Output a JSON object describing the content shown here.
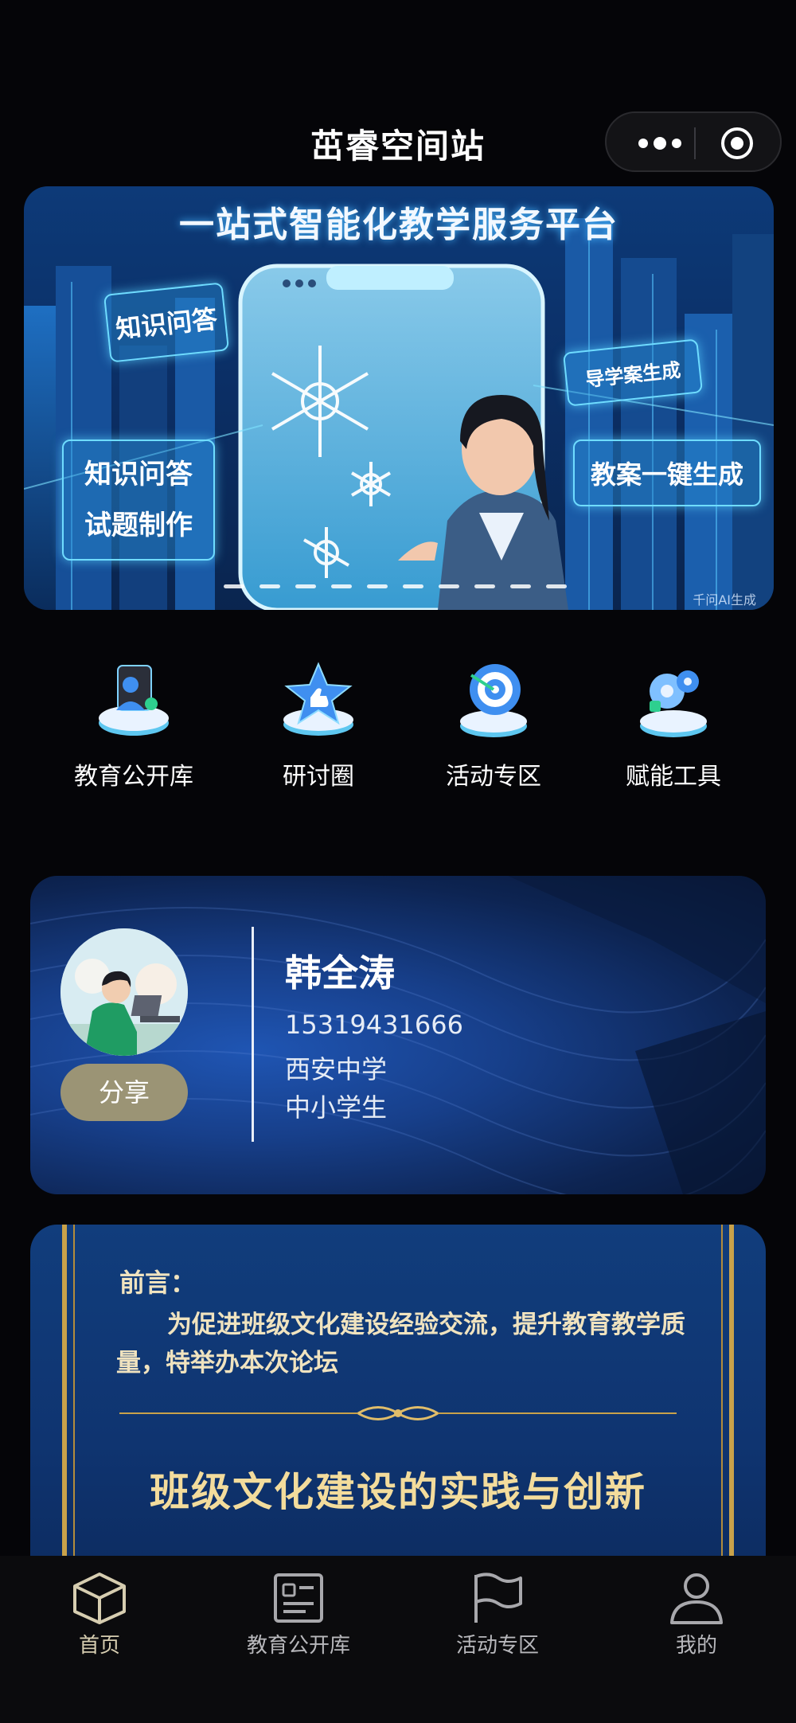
{
  "header": {
    "title": "茁睿空间站",
    "more_icon": "more-dots-icon",
    "close_icon": "target-circle-icon"
  },
  "banner": {
    "headline": "一站式智能化教学服务平台",
    "sign_top_left": "知识问答",
    "sign_left_line1": "知识问答",
    "sign_left_line2": "试题制作",
    "sign_right_small": "导学案生成",
    "sign_right_big": "教案一键生成",
    "watermark": "千问AI生成",
    "slide_count": 10,
    "active_slide": 1
  },
  "menu": {
    "items": [
      {
        "label": "教育公开库",
        "icon": "education-library-icon"
      },
      {
        "label": "研讨圈",
        "icon": "discussion-star-icon"
      },
      {
        "label": "活动专区",
        "icon": "activity-target-icon"
      },
      {
        "label": "赋能工具",
        "icon": "tools-gear-icon"
      }
    ]
  },
  "profile": {
    "name": "韩全涛",
    "phone": "15319431666",
    "school": "西安中学",
    "role": "中小学生",
    "share_label": "分享",
    "share_color": "#9b9475"
  },
  "poster": {
    "preface_title": "前言：",
    "preface_text": "为促进班级文化建设经验交流，提升教育教学质量，特举办本次论坛",
    "heading": "班级文化建设的实践与创新",
    "accent_color": "#c9a24a"
  },
  "tabbar": {
    "items": [
      {
        "label": "首页",
        "icon": "home-cube-icon",
        "active": true
      },
      {
        "label": "教育公开库",
        "icon": "id-card-icon",
        "active": false
      },
      {
        "label": "活动专区",
        "icon": "flag-icon",
        "active": false
      },
      {
        "label": "我的",
        "icon": "user-icon",
        "active": false
      }
    ]
  }
}
